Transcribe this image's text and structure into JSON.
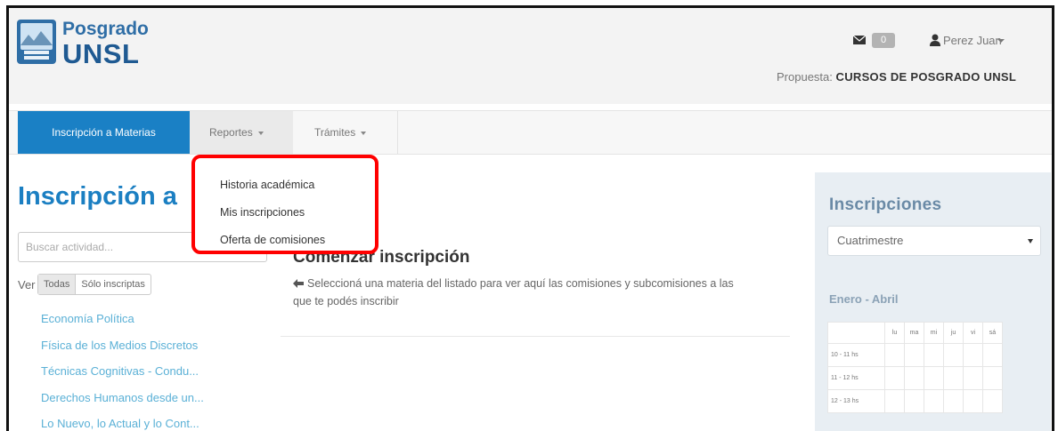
{
  "header": {
    "logo_line1": "Posgrado",
    "logo_line2": "UNSL",
    "mail_count": "0",
    "user_name": "Perez Juan",
    "propuesta_label": "Propuesta:",
    "propuesta_value": "CURSOS DE POSGRADO UNSL"
  },
  "nav": {
    "items": [
      {
        "label": "Inscripción a Materias",
        "active": true
      },
      {
        "label": "Reportes",
        "dropdown": true
      },
      {
        "label": "Trámites",
        "dropdown": true
      }
    ]
  },
  "dropdown": {
    "items": [
      "Historia académica",
      "Mis inscripciones",
      "Oferta de comisiones"
    ],
    "highlight_color": "#ff0000"
  },
  "left": {
    "title": "Inscripción a",
    "search_placeholder": "Buscar actividad...",
    "ver_label": "Ver",
    "filters": [
      "Todas",
      "Sólo inscriptas"
    ],
    "activities": [
      "Economía Política",
      "Física de los Medios Discretos",
      "Técnicas Cognitivas - Condu...",
      "Derechos Humanos desde un...",
      "Lo Nuevo, lo Actual y lo Cont..."
    ]
  },
  "main": {
    "title": "Comenzar inscripción",
    "message": "Seleccioná una materia del listado para ver aquí las comisiones y subcomisiones a las que te podés inscribir"
  },
  "right": {
    "title": "Inscripciones",
    "select_value": "Cuatrimestre",
    "period": "Enero - Abril",
    "days": [
      "lu",
      "ma",
      "mi",
      "ju",
      "vi",
      "sá"
    ],
    "hours": [
      "10 - 11 hs",
      "11 - 12 hs",
      "12 - 13 hs"
    ]
  },
  "colors": {
    "brand_blue": "#1a80c5",
    "link_blue": "#5ab0d6",
    "title_blue": "#1b7fc2"
  }
}
